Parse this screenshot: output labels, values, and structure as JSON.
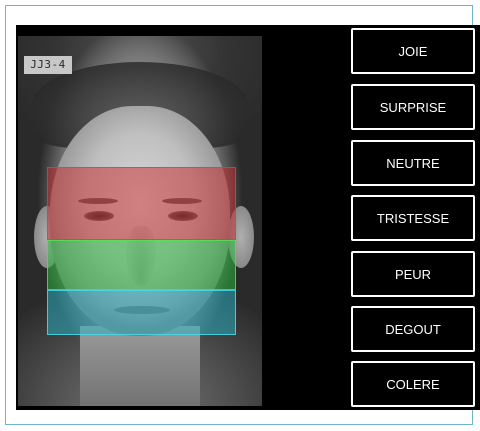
{
  "photo": {
    "tag": "JJ3-4"
  },
  "emotions": [
    {
      "label": "JOIE"
    },
    {
      "label": "SURPRISE"
    },
    {
      "label": "NEUTRE"
    },
    {
      "label": "TRISTESSE"
    },
    {
      "label": "PEUR"
    },
    {
      "label": "DEGOUT"
    },
    {
      "label": "COLERE"
    }
  ],
  "colors": {
    "frame_border": "#6fb3cf",
    "stage_background": "#000000",
    "button_border": "#ffffff",
    "upper_region": "#c82828",
    "middle_region": "#28be3c",
    "lower_region": "#28b4c8"
  }
}
